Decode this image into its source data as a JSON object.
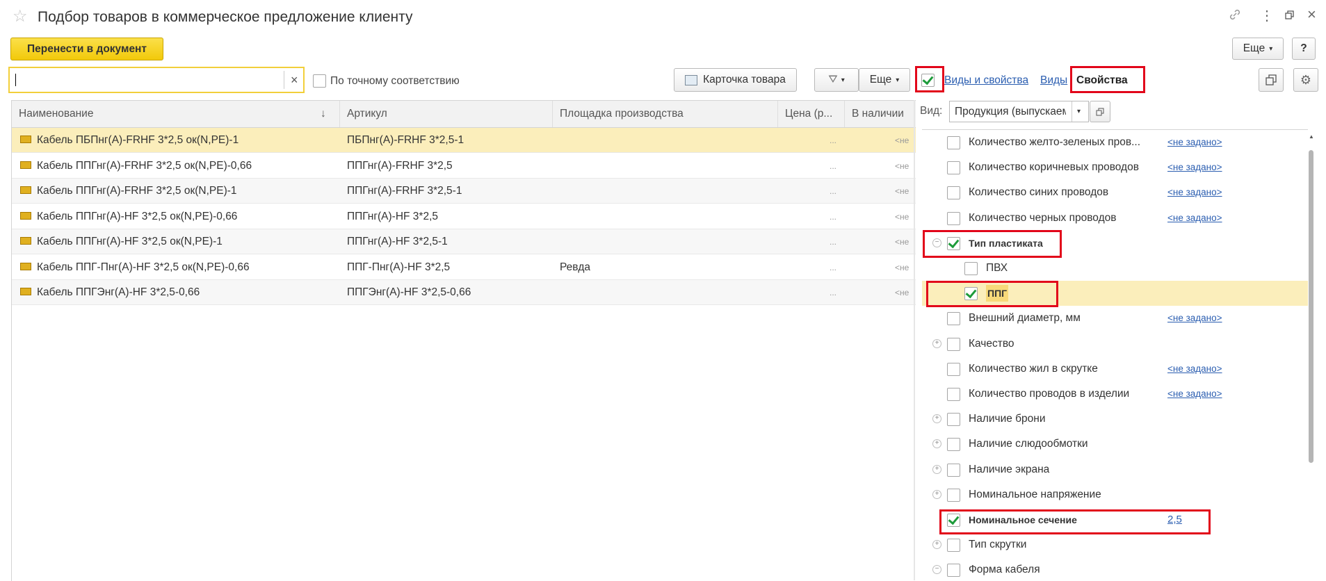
{
  "window": {
    "title": "Подбор товаров в коммерческое предложение клиенту"
  },
  "toolbar": {
    "transfer_label": "Перенести в документ",
    "more_label": "Еще",
    "help_label": "?"
  },
  "search": {
    "value": "",
    "clear_label": "×",
    "exact_match_label": "По точному соответствию"
  },
  "tools": {
    "product_card_label": "Карточка товара",
    "more_label": "Еще",
    "views_props_link": "Виды и свойства",
    "views_link": "Виды",
    "props_label": "Свойства"
  },
  "table": {
    "headers": [
      "Наименование",
      "Артикул",
      "Площадка производства",
      "Цена (р...",
      "В наличии"
    ],
    "sort_indicator": "↓",
    "rows": [
      {
        "name": "Кабель ПБПнг(А)-FRHF 3*2,5 ок(N,PE)-1",
        "article": "ПБПнг(А)-FRHF 3*2,5-1",
        "site": "",
        "price": "...",
        "stock": "<не"
      },
      {
        "name": "Кабель ППГнг(А)-FRHF 3*2,5 ок(N,PE)-0,66",
        "article": "ППГнг(А)-FRHF 3*2,5",
        "site": "",
        "price": "...",
        "stock": "<не"
      },
      {
        "name": "Кабель ППГнг(А)-FRHF 3*2,5 ок(N,PE)-1",
        "article": "ППГнг(А)-FRHF 3*2,5-1",
        "site": "",
        "price": "...",
        "stock": "<не"
      },
      {
        "name": "Кабель ППГнг(А)-HF 3*2,5 ок(N,PE)-0,66",
        "article": "ППГнг(А)-HF 3*2,5",
        "site": "",
        "price": "...",
        "stock": "<не"
      },
      {
        "name": "Кабель ППГнг(А)-HF 3*2,5 ок(N,PE)-1",
        "article": "ППГнг(А)-HF 3*2,5-1",
        "site": "",
        "price": "...",
        "stock": "<не"
      },
      {
        "name": "Кабель ППГ-Пнг(А)-HF 3*2,5 ок(N,PE)-0,66",
        "article": "ППГ-Пнг(А)-HF 3*2,5",
        "site": "Ревда",
        "price": "...",
        "stock": "<не"
      },
      {
        "name": "Кабель ППГЭнг(А)-HF 3*2,5-0,66",
        "article": "ППГЭнг(А)-HF 3*2,5-0,66",
        "site": "",
        "price": "...",
        "stock": "<не"
      }
    ]
  },
  "props": {
    "kind_label": "Вид:",
    "kind_value": "Продукция (выпускаемая",
    "items": [
      {
        "label": "Количество желто-зеленых пров...",
        "value": "<не задано>",
        "checked": false,
        "bold": false,
        "expander": ""
      },
      {
        "label": "Количество коричневых проводов",
        "value": "<не задано>",
        "checked": false,
        "bold": false,
        "expander": ""
      },
      {
        "label": "Количество синих проводов",
        "value": "<не задано>",
        "checked": false,
        "bold": false,
        "expander": ""
      },
      {
        "label": "Количество черных проводов",
        "value": "<не задано>",
        "checked": false,
        "bold": false,
        "expander": ""
      },
      {
        "label": "Тип пластиката",
        "value": "",
        "checked": true,
        "bold": true,
        "expander": "minus"
      },
      {
        "label": "ПВХ",
        "value": "",
        "checked": false,
        "bold": false,
        "expander": "",
        "child": true
      },
      {
        "label": "ППГ",
        "value": "",
        "checked": true,
        "bold": true,
        "expander": "",
        "child": true,
        "selected": true
      },
      {
        "label": "Внешний диаметр, мм",
        "value": "<не задано>",
        "checked": false,
        "bold": false,
        "expander": ""
      },
      {
        "label": "Качество",
        "value": "",
        "checked": false,
        "bold": false,
        "expander": "plus"
      },
      {
        "label": "Количество жил в скрутке",
        "value": "<не задано>",
        "checked": false,
        "bold": false,
        "expander": ""
      },
      {
        "label": "Количество проводов в изделии",
        "value": "<не задано>",
        "checked": false,
        "bold": false,
        "expander": ""
      },
      {
        "label": "Наличие брони",
        "value": "",
        "checked": false,
        "bold": false,
        "expander": "plus"
      },
      {
        "label": "Наличие слюдообмотки",
        "value": "",
        "checked": false,
        "bold": false,
        "expander": "plus"
      },
      {
        "label": "Наличие экрана",
        "value": "",
        "checked": false,
        "bold": false,
        "expander": "plus"
      },
      {
        "label": "Номинальное напряжение",
        "value": "",
        "checked": false,
        "bold": false,
        "expander": "plus"
      },
      {
        "label": "Номинальное сечение",
        "value": "2,5",
        "checked": true,
        "bold": true,
        "expander": ""
      },
      {
        "label": "Тип скрутки",
        "value": "",
        "checked": false,
        "bold": false,
        "expander": "plus"
      },
      {
        "label": "Форма кабеля",
        "value": "",
        "checked": false,
        "bold": false,
        "expander": "minus"
      }
    ]
  },
  "colors": {
    "accent_yellow": "#f5d10f",
    "selection": "#fbeebb",
    "highlight_red": "#e2061a",
    "link_blue": "#2a5db0",
    "check_green": "#1d9b3a"
  }
}
